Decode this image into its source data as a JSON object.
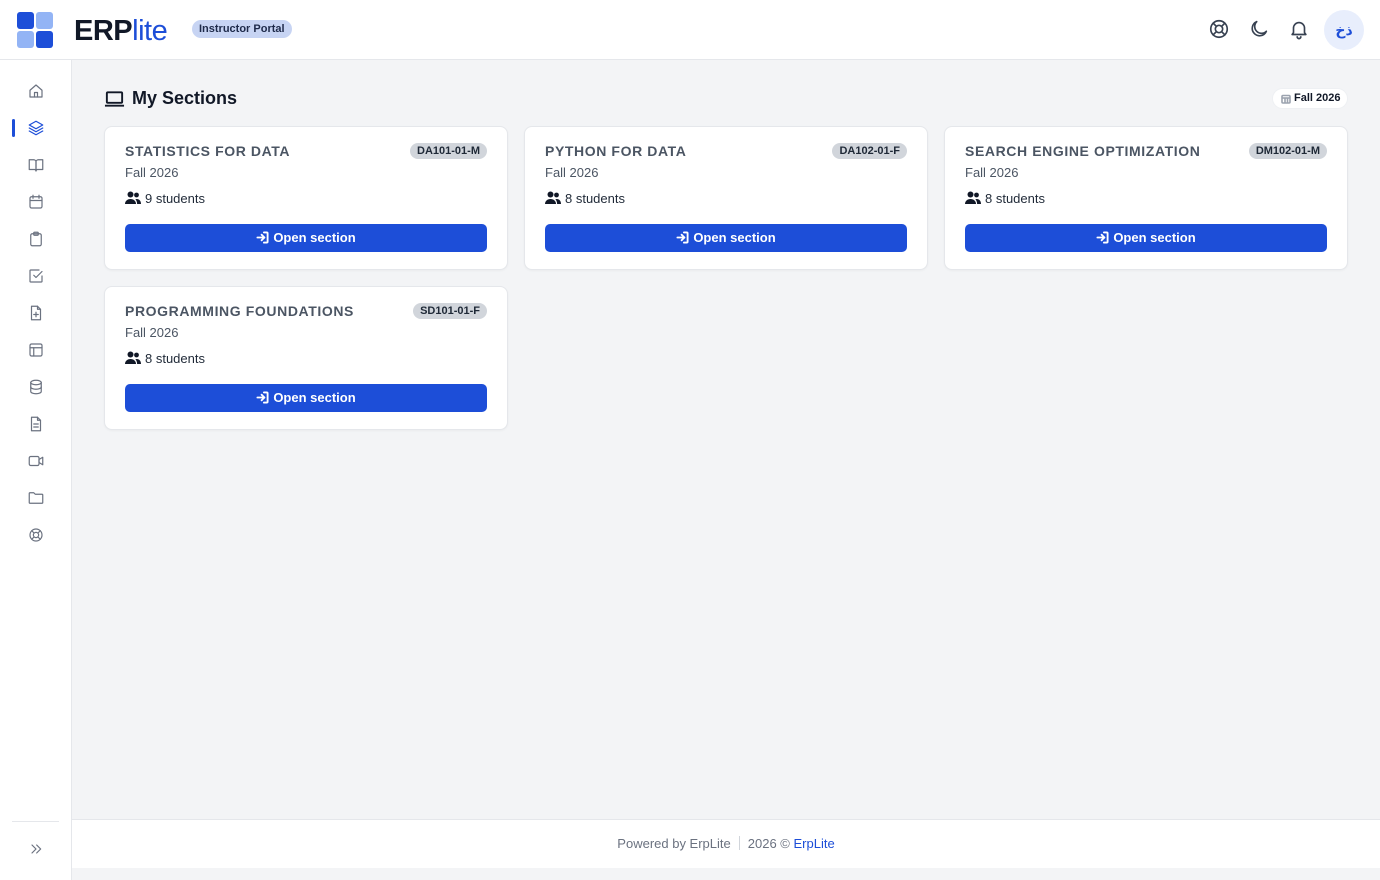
{
  "header": {
    "brand_bold": "ERP",
    "brand_light": "lite",
    "portal_badge": "Instructor Portal",
    "avatar_initials": "ذخ",
    "icons": [
      "help-lifebuoy-icon",
      "moon-icon",
      "bell-icon"
    ]
  },
  "sidebar": {
    "items": [
      {
        "icon": "home-icon",
        "active": false
      },
      {
        "icon": "layers-icon",
        "active": true
      },
      {
        "icon": "book-icon",
        "active": false
      },
      {
        "icon": "calendar-icon",
        "active": false
      },
      {
        "icon": "clipboard-icon",
        "active": false
      },
      {
        "icon": "check-square-icon",
        "active": false
      },
      {
        "icon": "file-plus-icon",
        "active": false
      },
      {
        "icon": "layout-icon",
        "active": false
      },
      {
        "icon": "database-icon",
        "active": false
      },
      {
        "icon": "file-text-icon",
        "active": false
      },
      {
        "icon": "video-icon",
        "active": false
      },
      {
        "icon": "folder-icon",
        "active": false
      },
      {
        "icon": "lifebuoy-icon",
        "active": false
      }
    ]
  },
  "main": {
    "title": "My Sections",
    "term_pill": "Fall 2026",
    "sections": [
      {
        "title": "STATISTICS FOR DATA",
        "code": "DA101-01-M",
        "term": "Fall 2026",
        "students": "9 students",
        "button": "Open section"
      },
      {
        "title": "PYTHON FOR DATA",
        "code": "DA102-01-F",
        "term": "Fall 2026",
        "students": "8 students",
        "button": "Open section"
      },
      {
        "title": "SEARCH ENGINE OPTIMIZATION",
        "code": "DM102-01-M",
        "term": "Fall 2026",
        "students": "8 students",
        "button": "Open section"
      },
      {
        "title": "PROGRAMMING FOUNDATIONS",
        "code": "SD101-01-F",
        "term": "Fall 2026",
        "students": "8 students",
        "button": "Open section"
      }
    ]
  },
  "footer": {
    "powered": "Powered by ErpLite",
    "copyright": "2026 ©",
    "link": "ErpLite"
  },
  "colors": {
    "accent": "#1d4ed8",
    "page_bg": "#f3f4f6"
  }
}
